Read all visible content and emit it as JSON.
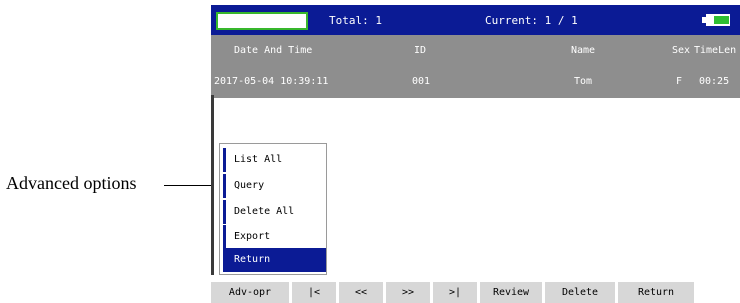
{
  "annotation": {
    "label": "Advanced options"
  },
  "status_bar": {
    "total": "Total: 1",
    "current": "Current: 1 / 1"
  },
  "table": {
    "headers": {
      "date": "Date And Time",
      "id": "ID",
      "name": "Name",
      "sex": "Sex",
      "time": "TimeLen"
    },
    "rows": [
      {
        "date": "2017-05-04 10:39:11",
        "id": "001",
        "name": "Tom",
        "sex": "F",
        "time": "00:25"
      }
    ]
  },
  "menu": {
    "items": [
      {
        "label": "List All"
      },
      {
        "label": "Query"
      },
      {
        "label": "Delete All"
      },
      {
        "label": "Export"
      },
      {
        "label": "Return"
      }
    ],
    "selected": "Return"
  },
  "buttons": {
    "adv_opr": "Adv-opr",
    "first": "|<",
    "prev": "<<",
    "next": ">>",
    "last": ">|",
    "review": "Review",
    "delete": "Delete",
    "return": "Return"
  },
  "colors": {
    "top_bar": "#0b1b95",
    "table_bg": "#8e8e8e",
    "accent_green": "#38b72c",
    "button_bg": "#d7d7d7"
  }
}
